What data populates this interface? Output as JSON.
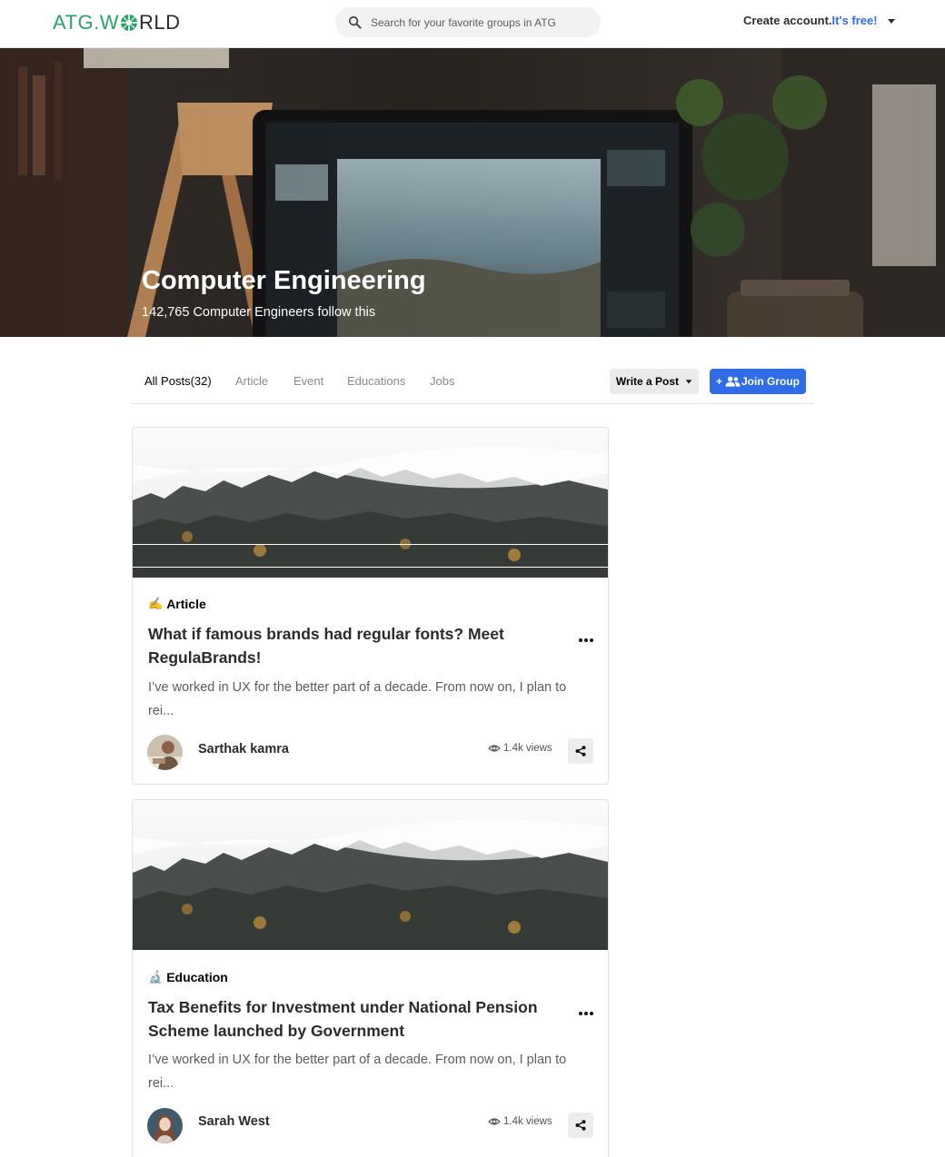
{
  "header": {
    "logo": {
      "part1": "ATG.W",
      "part2": "RLD"
    },
    "search_placeholder": "Search for your favorite groups in ATG",
    "account": {
      "label": "Create account.",
      "highlight": "It's free!"
    }
  },
  "hero": {
    "title": "Computer Engineering",
    "subtitle": "142,765 Computer Engineers follow this"
  },
  "tabs": [
    {
      "label": "All Posts(32)",
      "active": true
    },
    {
      "label": "Article"
    },
    {
      "label": "Event"
    },
    {
      "label": "Educations"
    },
    {
      "label": "Jobs"
    }
  ],
  "actions": {
    "write_post": "Write a Post",
    "join_group_prefix": "+",
    "join_group": "Join Group"
  },
  "posts": [
    {
      "category_icon": "✍️",
      "category": "Article",
      "title": "What if famous brands had regular fonts? Meet RegulaBrands!",
      "excerpt": "I’ve worked in UX for the better part of a decade. From now on, I plan to rei...",
      "author": "Sarthak kamra",
      "views": "1.4k views"
    },
    {
      "category_icon": "🔬",
      "category": "Education",
      "title": "Tax Benefits for Investment under National Pension Scheme launched by Government",
      "excerpt": "I’ve worked in UX for the better part of a decade. From now on, I plan to rei...",
      "author": "Sarah West",
      "views": "1.4k views"
    }
  ],
  "colors": {
    "brand_green": "#27a365",
    "accent_blue": "#2f6ce5"
  }
}
